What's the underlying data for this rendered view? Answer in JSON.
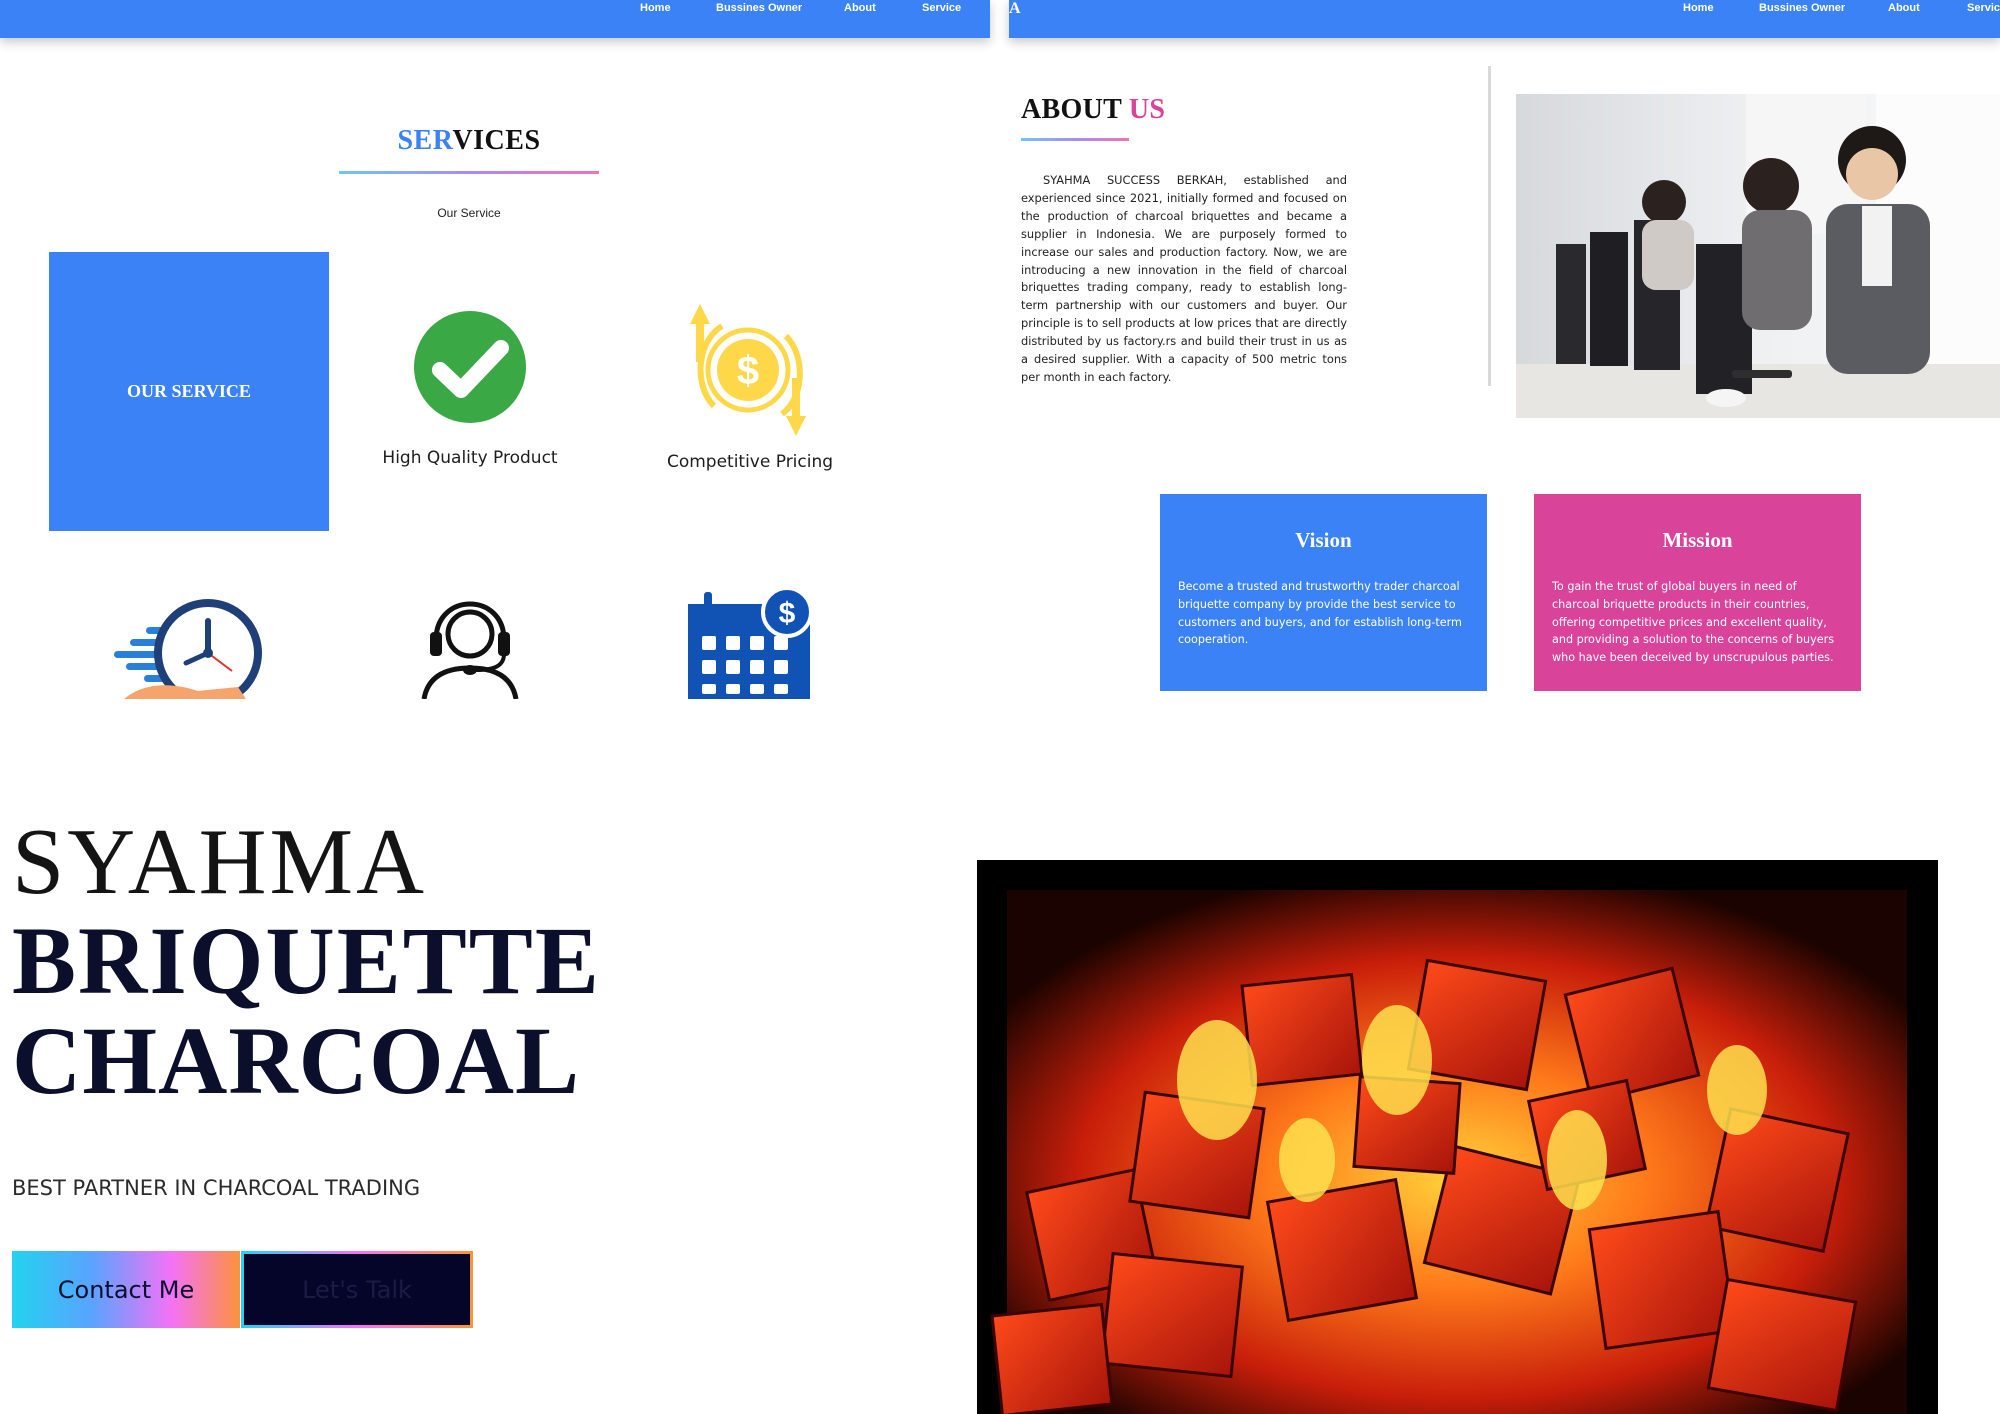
{
  "left_page": {
    "nav": [
      "Home",
      "Bussines Owner",
      "About",
      "Service"
    ],
    "services": {
      "title_part1": "SER",
      "title_part2": "VICES",
      "subtitle": "Our Service",
      "box_label": "OUR SERVICE",
      "items": [
        "High Quality Product",
        "Competitive Pricing"
      ],
      "icons": [
        "check-icon",
        "dollar-exchange-icon",
        "fast-clock-icon",
        "customer-support-icon",
        "payment-calendar-icon"
      ]
    }
  },
  "right_page": {
    "brand_fragment": "A",
    "nav": [
      "Home",
      "Bussines Owner",
      "About",
      "Service"
    ],
    "about": {
      "title_part1": "ABOUT ",
      "title_part2": "US",
      "body": "SYAHMA SUCCESS BERKAH, established and experienced since 2021, initially formed and focused on the production of charcoal briquettes and became a supplier in Indonesia. We are purposely formed to increase our sales and production factory. Now, we are introducing a new innovation in the field of charcoal briquettes trading company, ready to establish long-term partnership with our customers and buyer. Our principle is to sell products at low prices that are directly distributed by us factory.rs and build their trust in us as a desired supplier. With a capacity of 500 metric tons per month in each factory."
    },
    "vision": {
      "title": "Vision",
      "text": "Become a trusted and trustworthy trader charcoal briquette company by provide the best service to customers and buyers, and for establish long-term cooperation."
    },
    "mission": {
      "title": "Mission",
      "text": "To gain the trust of global buyers in need of charcoal briquette products in their countries, offering competitive prices and excellent quality, and providing a solution to the concerns of buyers who have been deceived by unscrupulous parties."
    }
  },
  "hero": {
    "line1": "SYAHMA",
    "line2": "BRIQUETTE",
    "line3": "CHARCOAL",
    "tagline": "BEST PARTNER IN CHARCOAL TRADING",
    "contact_button": "Contact Me",
    "talk_button": "Let's Talk"
  },
  "colors": {
    "nav_blue": "#3b82f6",
    "accent_blue": "#3b82f6",
    "accent_pink": "#d9439a",
    "check_green": "#3aa845",
    "coin_yellow": "#ffd84a",
    "calendar_blue": "#1152b5",
    "hero_navy": "#0b0f2c"
  }
}
